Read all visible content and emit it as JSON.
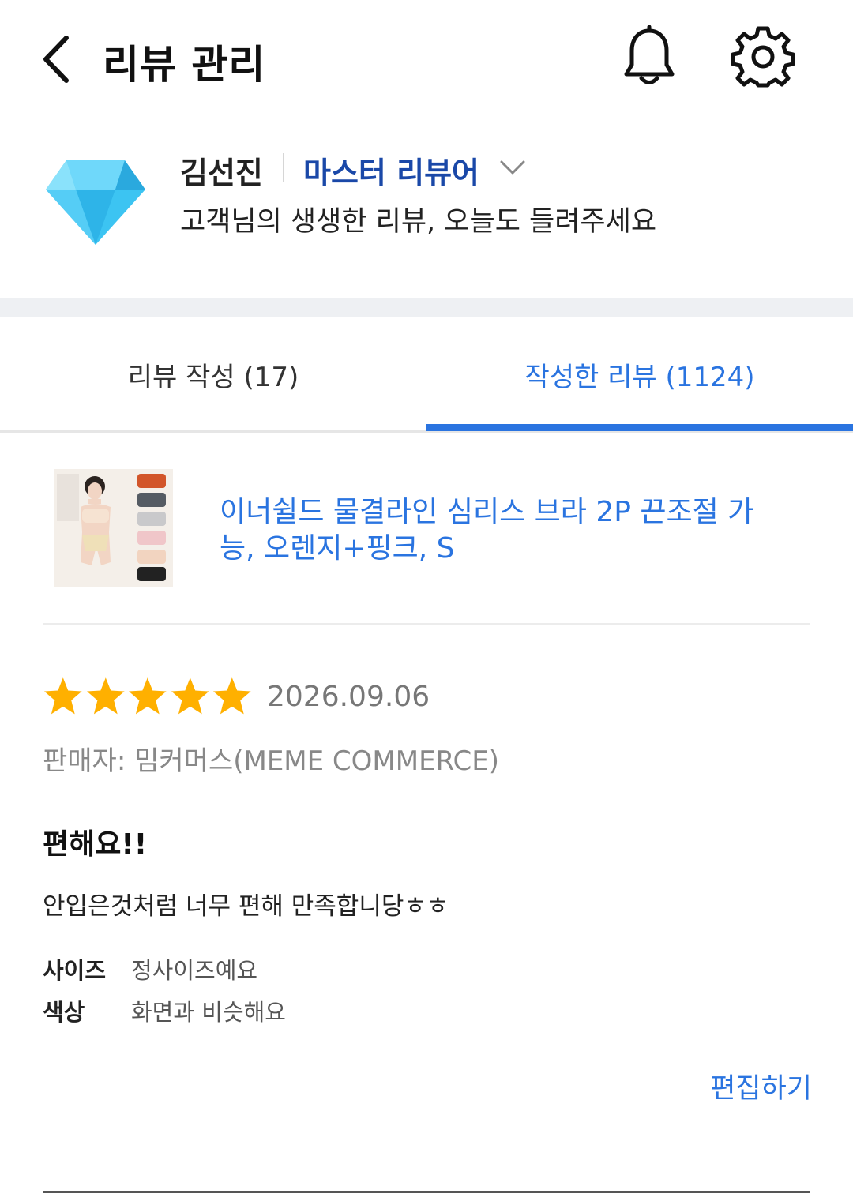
{
  "header": {
    "title": "리뷰 관리",
    "back_icon": "chevron-left-icon",
    "bell_icon": "bell-icon",
    "settings_icon": "gear-icon"
  },
  "profile": {
    "badge_icon": "diamond-icon",
    "name": "김선진",
    "rank": "마스터 리뷰어",
    "tagline": "고객님의 생생한 리뷰, 오늘도 들려주세요"
  },
  "tabs": [
    {
      "label": "리뷰 작성 (17)",
      "active": false
    },
    {
      "label": "작성한 리뷰 (1124)",
      "active": true
    }
  ],
  "review": {
    "product_name": "이너쉴드 물결라인 심리스 브라 2P 끈조절 가능, 오렌지+핑크, S",
    "rating": 5,
    "date": "2026.09.06",
    "seller": "판매자: 밈커머스(MEME COMMERCE)",
    "title": "편해요!!",
    "body": "안입은것처럼 너무 편해 만족합니당ㅎㅎ",
    "attributes": [
      {
        "label": "사이즈",
        "value": "정사이즈예요"
      },
      {
        "label": "색상",
        "value": "화면과 비슷해요"
      }
    ],
    "edit_label": "편집하기"
  },
  "colors": {
    "accent": "#2a74e0",
    "rank": "#1a48a8",
    "star": "#ffb000",
    "tab_bar": "#2a74e0"
  }
}
